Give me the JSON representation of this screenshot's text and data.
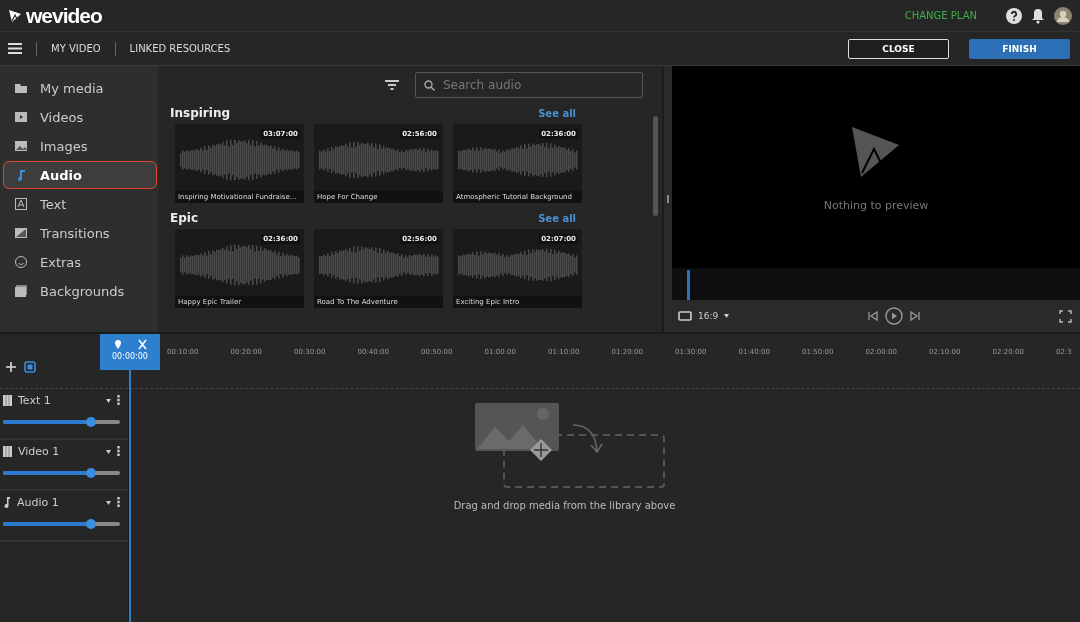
{
  "header": {
    "logo": "wevideo",
    "change_plan": "CHANGE PLAN"
  },
  "nav": {
    "items": [
      "MY VIDEO",
      "LINKED RESOURCES"
    ],
    "close": "CLOSE",
    "finish": "FINISH"
  },
  "sidebar": {
    "items": [
      {
        "label": "My media",
        "selected": false
      },
      {
        "label": "Videos",
        "selected": false
      },
      {
        "label": "Images",
        "selected": false
      },
      {
        "label": "Audio",
        "selected": true
      },
      {
        "label": "Text",
        "selected": false
      },
      {
        "label": "Transitions",
        "selected": false
      },
      {
        "label": "Extras",
        "selected": false
      },
      {
        "label": "Backgrounds",
        "selected": false
      }
    ]
  },
  "library": {
    "search": {
      "placeholder": "Search audio"
    },
    "sections": [
      {
        "title": "Inspiring",
        "see_all": "See all",
        "tracks": [
          {
            "duration": "03:07:00",
            "title": "Inspiring Motivational Fundraise..."
          },
          {
            "duration": "02:56:00",
            "title": "Hope For Change"
          },
          {
            "duration": "02:36:00",
            "title": "Atmospheric Tutorial Background"
          }
        ]
      },
      {
        "title": "Epic",
        "see_all": "See all",
        "tracks": [
          {
            "duration": "02:36:00",
            "title": "Happy Epic Trailer"
          },
          {
            "duration": "02:56:00",
            "title": "Road To The Adventure"
          },
          {
            "duration": "02:07:00",
            "title": "Exciting Epic Intro"
          }
        ]
      }
    ]
  },
  "preview": {
    "message": "Nothing to preview",
    "aspect": "16:9"
  },
  "timeline": {
    "playhead": "00:00:00",
    "ruler": [
      "00:10:00",
      "00:20:00",
      "00:30:00",
      "00:40:00",
      "00:50:00",
      "01:00:00",
      "01:10:00",
      "01:20:00",
      "01:30:00",
      "01:40:00",
      "01:50:00",
      "02:00:00",
      "02:10:00",
      "02:20:00",
      "02:3"
    ],
    "tracks": [
      {
        "kind": "text",
        "name": "Text 1",
        "level": 0.75
      },
      {
        "kind": "video",
        "name": "Video 1",
        "level": 0.75
      },
      {
        "kind": "audio",
        "name": "Audio 1",
        "level": 0.75
      }
    ],
    "drop_hint": "Drag and drop media from the library above"
  }
}
